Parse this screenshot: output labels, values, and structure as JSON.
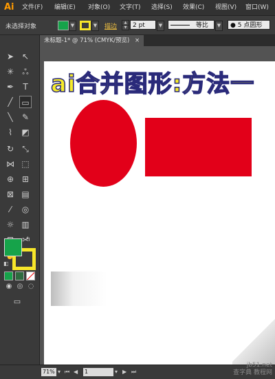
{
  "app": {
    "logo_text": "Ai"
  },
  "menu": [
    "文件(F)",
    "编辑(E)",
    "对象(O)",
    "文字(T)",
    "选择(S)",
    "效果(C)",
    "视图(V)",
    "窗口(W)"
  ],
  "control_bar": {
    "selection_status": "未选择对象",
    "fill_color": "#16a34a",
    "stroke_color": "#f7e62a",
    "stroke_label": "描边",
    "stroke_weight": "2 pt",
    "stroke_profile": "等比",
    "brush": "5 点圆形"
  },
  "document_tab": {
    "label": "未标题-1* @ 71% (CMYK/预览)",
    "close_glyph": "×"
  },
  "tools_panel": {
    "fill_color": "#16a34a",
    "stroke_color": "#f7e62a"
  },
  "artboard": {
    "headline": "ai合并图形:方法一",
    "shape_color": "#e20019"
  },
  "status_bar": {
    "zoom": "71%",
    "artboard_number": "1"
  },
  "watermark": {
    "line1": "jb51.net",
    "line2": "查字典 教程网"
  }
}
